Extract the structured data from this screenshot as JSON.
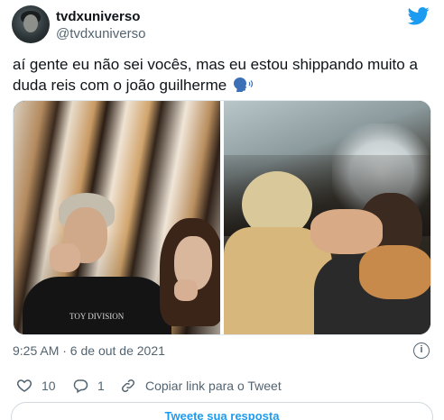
{
  "tweet": {
    "display_name": "tvdxuniverso",
    "username": "@tvdxuniverso",
    "text_line1": "aí gente eu não sei vocês, mas eu estou shippando muito a",
    "text_line2": "duda reis com o joão guilherme",
    "emoji": "speaking-head",
    "timestamp": "9:25 AM · 6 de out de 2021",
    "media": {
      "left_photo_shirt_text": "TOY DIVISION"
    }
  },
  "actions": {
    "likes": "10",
    "replies": "1",
    "copy_link_label": "Copiar link para o Tweet"
  },
  "reply_prompt": "Tweete sua resposta",
  "colors": {
    "twitter_blue": "#1d9bf0",
    "like_red": "#f91880",
    "secondary_text": "#536471"
  },
  "icons": [
    "twitter-bird-icon",
    "info-icon",
    "heart-icon",
    "reply-icon",
    "link-icon",
    "speaking-head-icon"
  ]
}
